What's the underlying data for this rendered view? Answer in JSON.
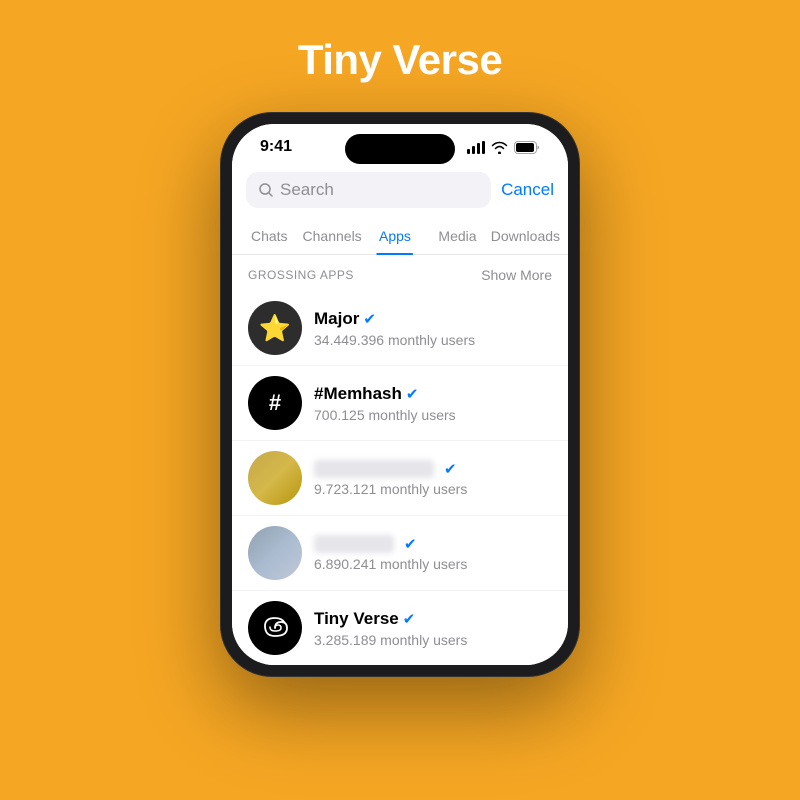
{
  "page": {
    "title": "Tiny Verse",
    "background_color": "#F5A623"
  },
  "status_bar": {
    "time": "9:41",
    "signal": "●●●●",
    "wifi": "wifi",
    "battery": "battery"
  },
  "search": {
    "placeholder": "Search",
    "cancel_label": "Cancel"
  },
  "tabs": [
    {
      "label": "Chats",
      "active": false
    },
    {
      "label": "Channels",
      "active": false
    },
    {
      "label": "Apps",
      "active": true
    },
    {
      "label": "Media",
      "active": false
    },
    {
      "label": "Downloads",
      "active": false
    }
  ],
  "section": {
    "label": "GROSSING APPS",
    "show_more": "Show More"
  },
  "apps": [
    {
      "name": "Major",
      "users": "34.449.396 monthly users",
      "avatar_type": "gold",
      "avatar_icon": "star",
      "verified": true,
      "blurred": false
    },
    {
      "name": "#Memhash",
      "users": "700.125 monthly users",
      "avatar_type": "black",
      "avatar_icon": "hash",
      "verified": true,
      "blurred": false
    },
    {
      "name": "",
      "users": "9.723.121 monthly users",
      "avatar_type": "yellow-gold",
      "avatar_icon": "",
      "verified": true,
      "blurred": true
    },
    {
      "name": "",
      "users": "6.890.241 monthly users",
      "avatar_type": "blue-gray",
      "avatar_icon": "",
      "verified": true,
      "blurred": true
    },
    {
      "name": "Tiny Verse",
      "users": "3.285.189 monthly users",
      "avatar_type": "black",
      "avatar_icon": "spiral",
      "verified": true,
      "blurred": false
    }
  ]
}
